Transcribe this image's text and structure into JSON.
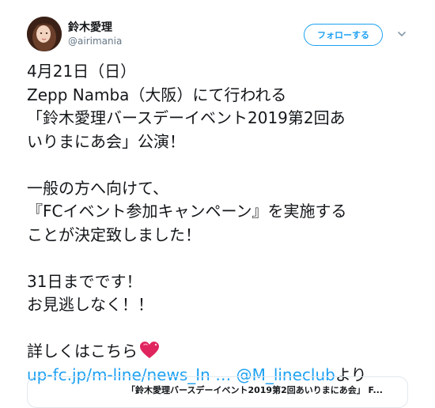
{
  "header": {
    "name": "鈴木愛理",
    "handle": "@airimania",
    "follow_label": "フォローする"
  },
  "tweet": {
    "lines": [
      "4月21日（日）",
      "Zepp Namba（大阪）にて行われる",
      "「鈴木愛理バースデーイベント2019第2回あ",
      "いりまにあ会」公演！",
      "",
      "一般の方へ向けて、",
      "『FCイベント参加キャンペーン』を実施する",
      "ことが決定致しました！",
      "",
      "31日までです！",
      "お見逃しなく！！",
      "",
      "詳しくはこちら"
    ],
    "link_url": "up-fc.jp/m-line/news_In …",
    "mention": "@M_lineclub",
    "suffix": "より"
  },
  "card": {
    "title": "「鈴木愛理バースデーイベント2019第2回あいりまにあ会」 F..."
  },
  "colors": {
    "accent": "#1da1f2",
    "text": "#14171a",
    "secondary": "#657786",
    "heart": "#e0245e"
  }
}
